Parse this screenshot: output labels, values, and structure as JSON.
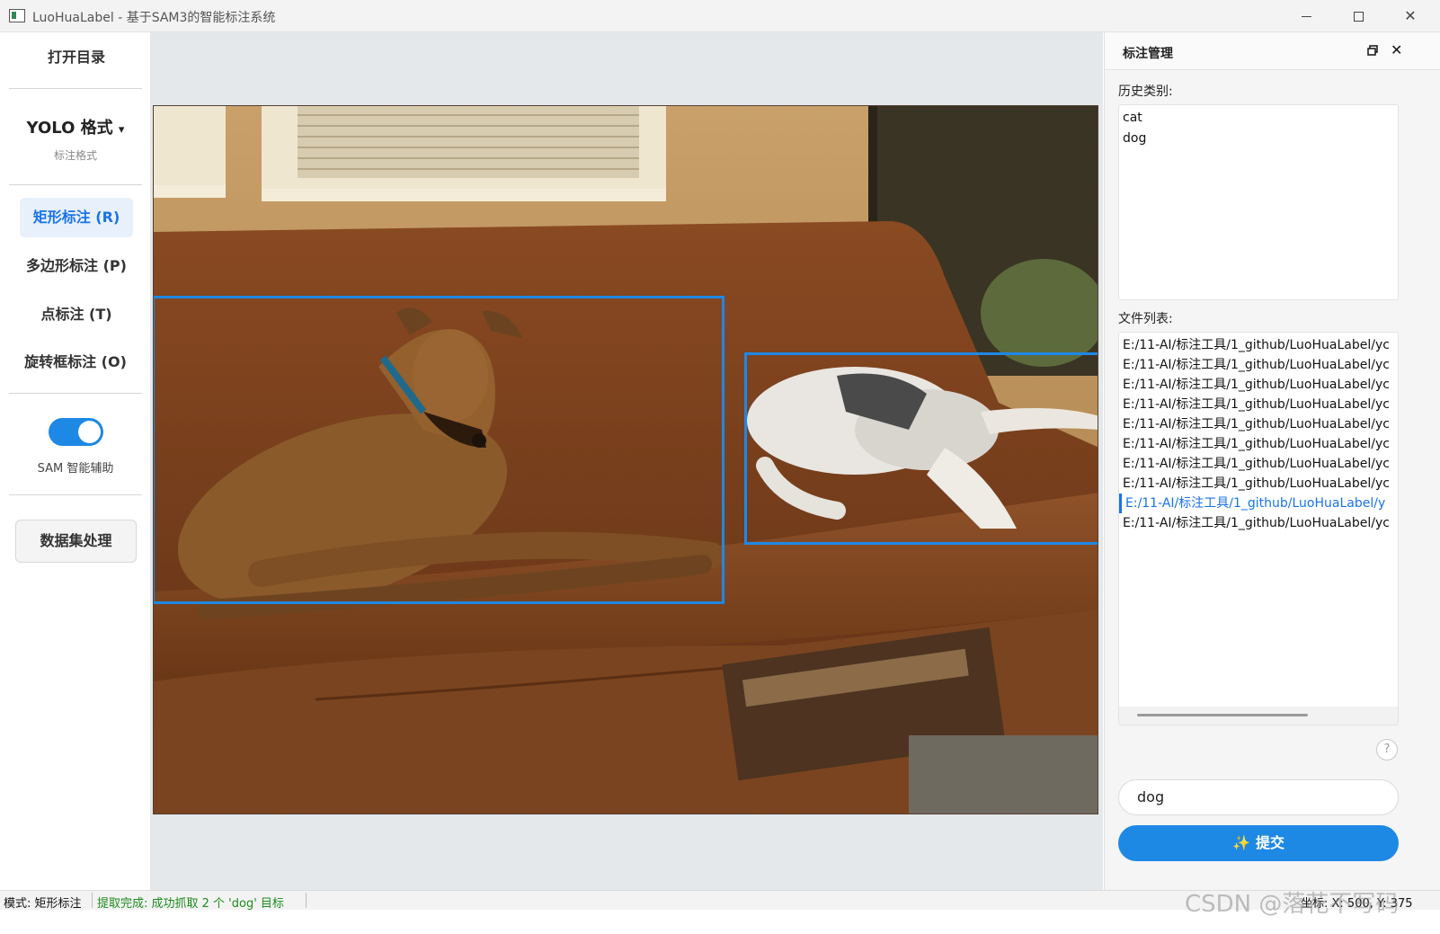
{
  "window": {
    "title": "LuoHuaLabel - 基于SAM3的智能标注系统"
  },
  "left_toolbar": {
    "open_dir": "打开目录",
    "format_title": "YOLO 格式",
    "format_caret": "▾",
    "format_sub": "标注格式",
    "tools": [
      {
        "label": "矩形标注 (R)",
        "active": true
      },
      {
        "label": "多边形标注 (P)",
        "active": false
      },
      {
        "label": "点标注 (T)",
        "active": false
      },
      {
        "label": "旋转框标注 (O)",
        "active": false
      }
    ],
    "sam_toggle_label": "SAM 智能辅助",
    "sam_enabled": true,
    "dataset_button": "数据集处理"
  },
  "canvas": {
    "annotation_color": "#1e88e5"
  },
  "right_panel": {
    "title": "标注管理",
    "history_label": "历史类别:",
    "history": [
      "cat",
      "dog"
    ],
    "file_list_label": "文件列表:",
    "files": [
      "E:/11-AI/标注工具/1_github/LuoHuaLabel/yc",
      "E:/11-AI/标注工具/1_github/LuoHuaLabel/yc",
      "E:/11-AI/标注工具/1_github/LuoHuaLabel/yc",
      "E:/11-AI/标注工具/1_github/LuoHuaLabel/yc",
      "E:/11-AI/标注工具/1_github/LuoHuaLabel/yc",
      "E:/11-AI/标注工具/1_github/LuoHuaLabel/yc",
      "E:/11-AI/标注工具/1_github/LuoHuaLabel/yc",
      "E:/11-AI/标注工具/1_github/LuoHuaLabel/yc",
      "E:/11-AI/标注工具/1_github/LuoHuaLabel/y",
      "E:/11-AI/标注工具/1_github/LuoHuaLabel/yc"
    ],
    "selected_file_index": 8,
    "help_label": "?",
    "prompt_value": "dog",
    "submit_label": "提交",
    "submit_icon": "✨"
  },
  "status_bar": {
    "mode": "模式: 矩形标注",
    "message": "提取完成: 成功抓取 2 个 'dog' 目标",
    "coords": "坐标: X: 500, Y: 375"
  },
  "watermark": "CSDN @落花不写码"
}
